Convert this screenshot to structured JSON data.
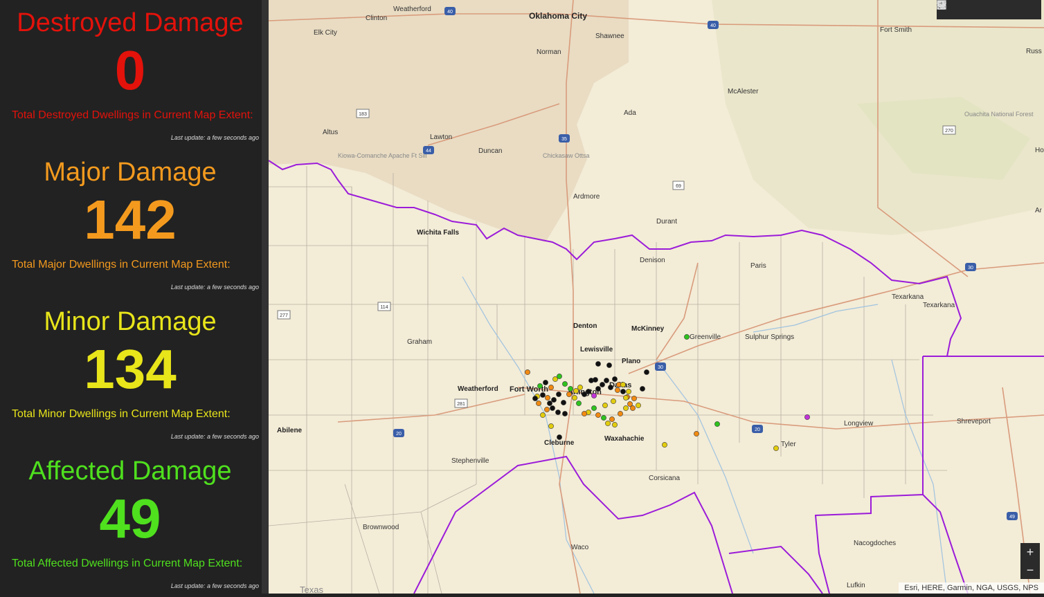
{
  "cards": [
    {
      "title": "Destroyed Damage",
      "value": "0",
      "caption": "Total Destroyed Dwellings in Current Map Extent:",
      "update": "Last update: a few seconds ago",
      "color": "#e3120b"
    },
    {
      "title": "Major Damage",
      "value": "142",
      "caption": "Total Major Dwellings in Current Map Extent:",
      "update": "Last update: a few seconds ago",
      "color": "#f39a1e"
    },
    {
      "title": "Minor Damage",
      "value": "134",
      "caption": "Total Minor Dwellings in Current Map Extent:",
      "update": "Last update: a few seconds ago",
      "color": "#e8e51a"
    },
    {
      "title": "Affected Damage",
      "value": "49",
      "caption": "Total Affected Dwellings in Current Map Extent:",
      "update": "Last update: a few seconds ago",
      "color": "#4fe01e"
    }
  ],
  "map": {
    "attribution": "Esri, HERE, Garmin, NGA, USGS, NPS",
    "boundary_color": "#9b1bd9",
    "toolbar": {
      "icons": [
        "search-icon",
        "home-icon",
        "list-icon",
        "layers-icon",
        "basemap-gallery-icon"
      ]
    },
    "zoom": {
      "in": "+",
      "out": "−"
    },
    "places": {
      "weatherford_ok": "Weatherford",
      "clinton": "Clinton",
      "okc": "Oklahoma City",
      "elk_city": "Elk City",
      "shawnee": "Shawnee",
      "fort_smith": "Fort Smith",
      "russ": "Russ",
      "norman": "Norman",
      "mcalester": "McAlester",
      "ada": "Ada",
      "ouachita": "Ouachita National Forest",
      "altus": "Altus",
      "lawton": "Lawton",
      "duncan": "Duncan",
      "kiowa": "Kiowa-Comanche Apache Ft Sill",
      "chickasaw": "Chickasaw Ottsa",
      "ho": "Ho",
      "ardmore": "Ardmore",
      "ar": "Ar",
      "durant": "Durant",
      "wichita_falls": "Wichita Falls",
      "denison": "Denison",
      "paris": "Paris",
      "texarkana1": "Texarkana",
      "texarkana2": "Texarkana",
      "graham": "Graham",
      "denton": "Denton",
      "mckinney": "McKinney",
      "greenville": "Greenville",
      "sulphur": "Sulphur Springs",
      "lewisville": "Lewisville",
      "plano": "Plano",
      "weatherford_tx": "Weatherford",
      "fort_worth": "Fort Worth",
      "arlington": "Arlington",
      "dallas": "Dallas",
      "abilene": "Abilene",
      "longview": "Longview",
      "shreveport": "Shreveport",
      "cleburne": "Cleburne",
      "waxahachie": "Waxahachie",
      "tyler": "Tyler",
      "stephenville": "Stephenville",
      "corsicana": "Corsicana",
      "brownwood": "Brownwood",
      "waco": "Waco",
      "nacogdoches": "Nacogdoches",
      "lufkin": "Lufkin",
      "texas": "Texas"
    },
    "shields": {
      "i40a": "40",
      "i40b": "40",
      "i35": "35",
      "i44": "44",
      "us183": "183",
      "us270": "270",
      "us69": "69",
      "i30a": "30",
      "i30b": "30",
      "us114": "114",
      "us277": "277",
      "us281": "281",
      "i20a": "20",
      "i20b": "20",
      "i49": "49"
    }
  },
  "legend_categories": [
    "destroyed",
    "major",
    "minor",
    "affected"
  ],
  "point_colors": {
    "major": "#f08a12",
    "minor": "#e2cc10",
    "affected": "#2fc21e",
    "other": "#111111",
    "special": "#c233d8"
  }
}
